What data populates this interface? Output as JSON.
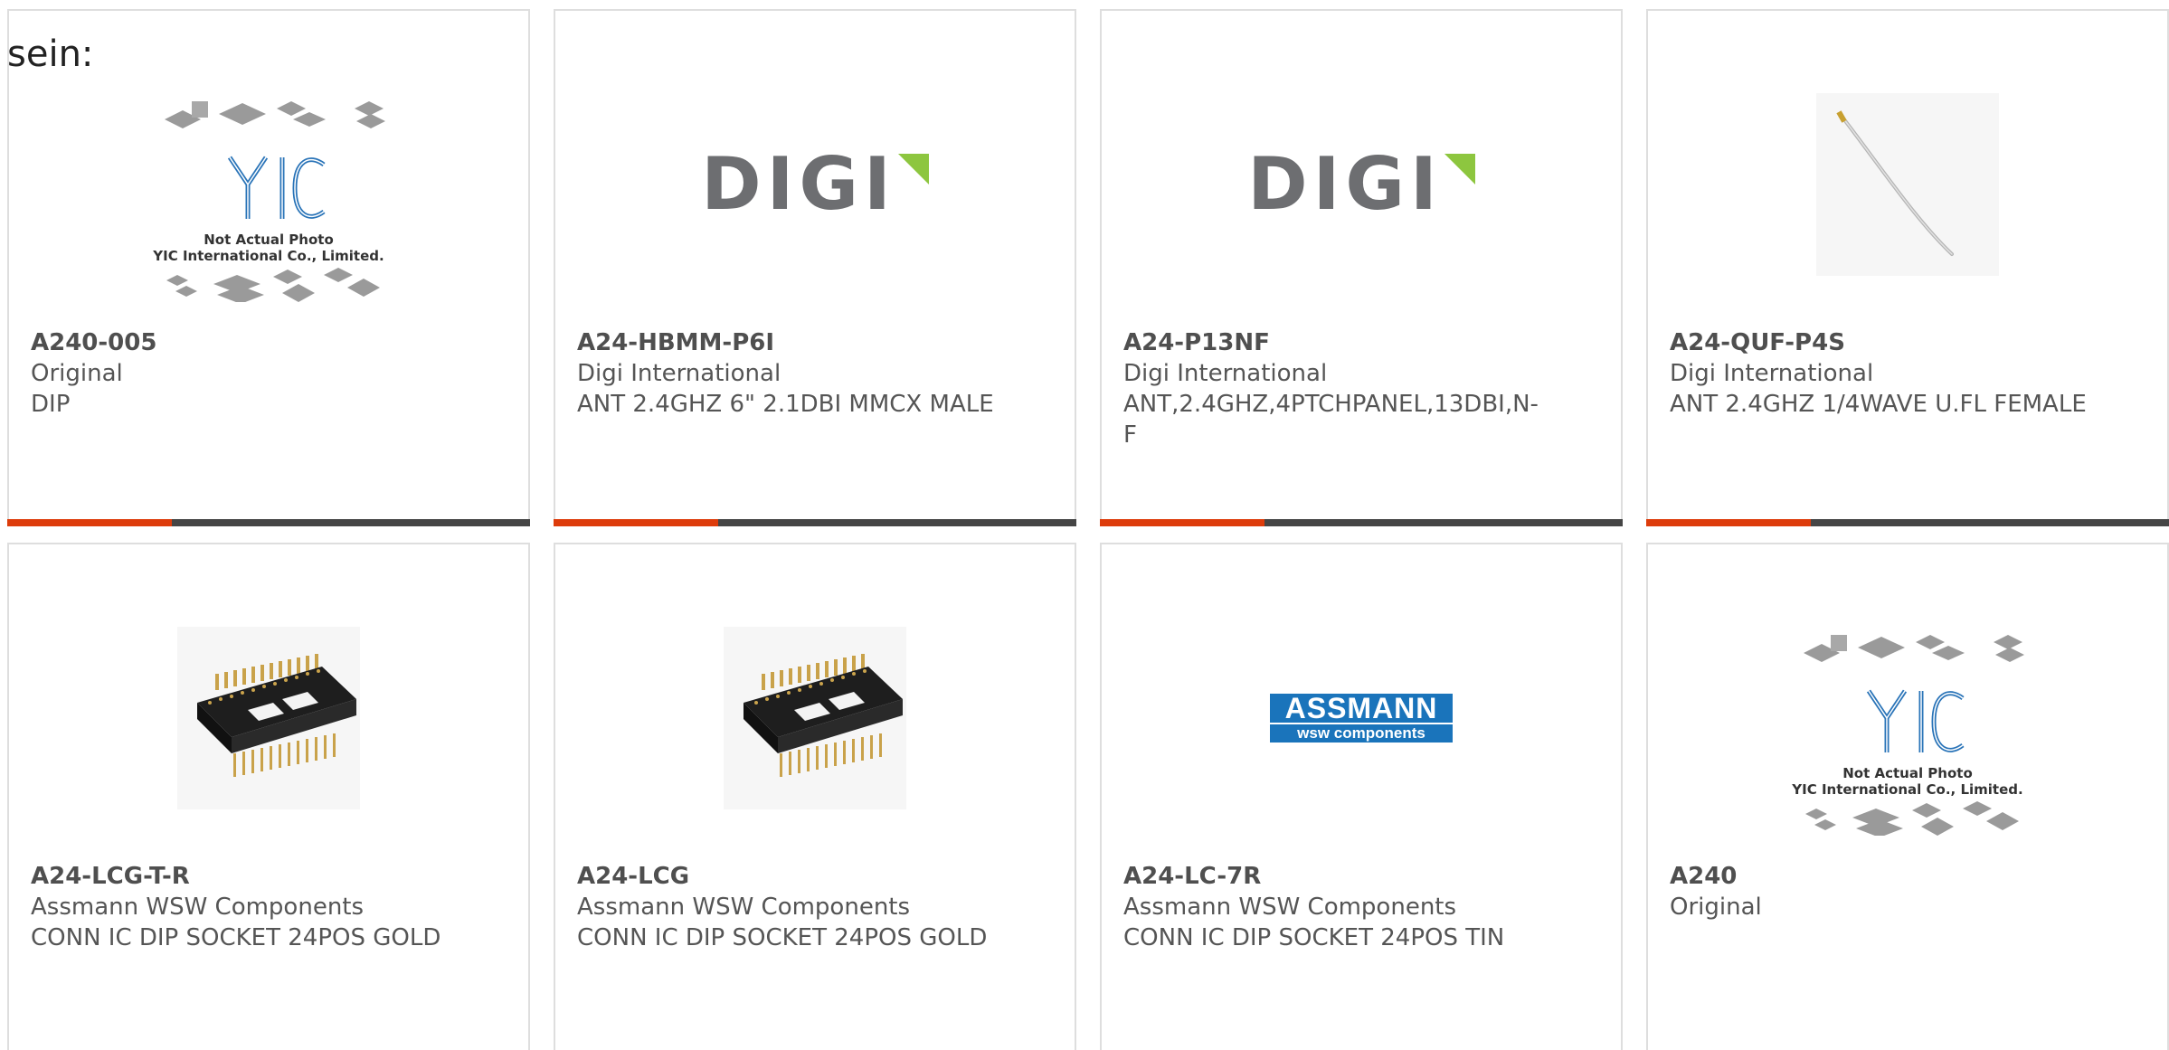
{
  "intro_text": "sein:",
  "brand": {
    "accent_color": "#dd3c0b",
    "bar_color": "#454545"
  },
  "placeholder_logo": {
    "caption_line1": "Not Actual Photo",
    "caption_line2": "YIC International Co., Limited.",
    "mark": "YIC"
  },
  "digi_logo": {
    "text": "DIGI"
  },
  "assmann_logo": {
    "top": "ASSMANN",
    "bottom": "wsw components"
  },
  "products": [
    {
      "part_number": "A240-005",
      "manufacturer": "Original",
      "description": "DIP",
      "image": "not-actual-photo-placeholder"
    },
    {
      "part_number": "A24-HBMM-P6I",
      "manufacturer": "Digi International",
      "description": "ANT 2.4GHZ 6\" 2.1DBI MMCX MALE",
      "image": "digi-logo"
    },
    {
      "part_number": "A24-P13NF",
      "manufacturer": "Digi International",
      "description": "ANT,2.4GHZ,4PTCHPANEL,13DBI,N-F",
      "image": "digi-logo"
    },
    {
      "part_number": "A24-QUF-P4S",
      "manufacturer": "Digi International",
      "description": "ANT 2.4GHZ 1/4WAVE U.FL FEMALE",
      "image": "antenna-cable-photo"
    },
    {
      "part_number": "A24-LCG-T-R",
      "manufacturer": "Assmann WSW Components",
      "description": "CONN IC DIP SOCKET 24POS GOLD",
      "image": "dip-socket-photo"
    },
    {
      "part_number": "A24-LCG",
      "manufacturer": "Assmann WSW Components",
      "description": "CONN IC DIP SOCKET 24POS GOLD",
      "image": "dip-socket-photo"
    },
    {
      "part_number": "A24-LC-7R",
      "manufacturer": "Assmann WSW Components",
      "description": "CONN IC DIP SOCKET 24POS TIN",
      "image": "assmann-logo"
    },
    {
      "part_number": "A240",
      "manufacturer": "Original",
      "description": "",
      "image": "not-actual-photo-placeholder"
    }
  ]
}
